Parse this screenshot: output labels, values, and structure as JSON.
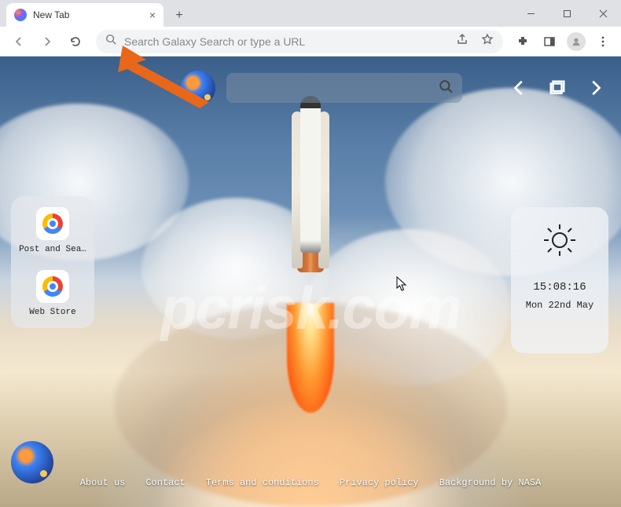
{
  "window": {
    "tab_title": "New Tab"
  },
  "omnibox": {
    "placeholder": "Search Galaxy Search or type a URL"
  },
  "newtab": {
    "search_placeholder": "",
    "shortcuts": [
      {
        "label": "Post and Sea…"
      },
      {
        "label": "Web Store"
      }
    ],
    "weather": {
      "time": "15:08:16",
      "date": "Mon 22nd May"
    },
    "footer": {
      "about": "About us",
      "contact": "Contact",
      "terms": "Terms and conditions",
      "privacy": "Privacy policy",
      "credit": "Background by NASA"
    }
  },
  "watermark": "pcrisk.com"
}
